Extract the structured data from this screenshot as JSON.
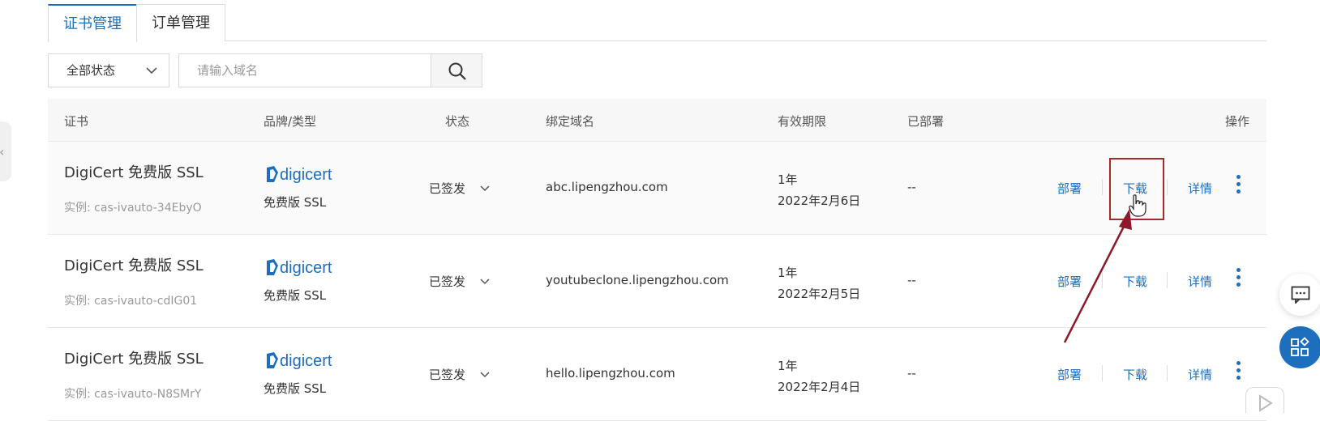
{
  "tabs": [
    {
      "label": "证书管理",
      "active": true
    },
    {
      "label": "订单管理",
      "active": false
    }
  ],
  "filter": {
    "status_select": "全部状态",
    "search_placeholder": "请输入域名"
  },
  "table": {
    "headers": {
      "cert": "证书",
      "brand": "品牌/类型",
      "status": "状态",
      "domain": "绑定域名",
      "validity": "有效期限",
      "deployed": "已部署",
      "actions": "操作"
    },
    "rows": [
      {
        "name": "DigiCert 免费版 SSL",
        "instance": "实例: cas-ivauto-34EbyO",
        "brand_logo": "digicert",
        "brand_type": "免费版 SSL",
        "status": "已签发",
        "domain": "abc.lipengzhou.com",
        "validity_period": "1年",
        "validity_date": "2022年2月6日",
        "deployed": "--"
      },
      {
        "name": "DigiCert 免费版 SSL",
        "instance": "实例: cas-ivauto-cdIG01",
        "brand_logo": "digicert",
        "brand_type": "免费版 SSL",
        "status": "已签发",
        "domain": "youtubeclone.lipengzhou.com",
        "validity_period": "1年",
        "validity_date": "2022年2月5日",
        "deployed": "--"
      },
      {
        "name": "DigiCert 免费版 SSL",
        "instance": "实例: cas-ivauto-N8SMrY",
        "brand_logo": "digicert",
        "brand_type": "免费版 SSL",
        "status": "已签发",
        "domain": "hello.lipengzhou.com",
        "validity_period": "1年",
        "validity_date": "2022年2月4日",
        "deployed": "--"
      }
    ],
    "actions": {
      "deploy": "部署",
      "download": "下载",
      "detail": "详情"
    }
  },
  "colors": {
    "accent": "#1d6fbd",
    "annotation": "#a52a2a"
  },
  "icons": [
    "chevron-down-icon",
    "search-icon",
    "more-vertical-icon",
    "chevron-left-icon",
    "chat-icon",
    "apps-icon",
    "play-icon",
    "cursor-hand-icon",
    "annotation-arrow"
  ]
}
